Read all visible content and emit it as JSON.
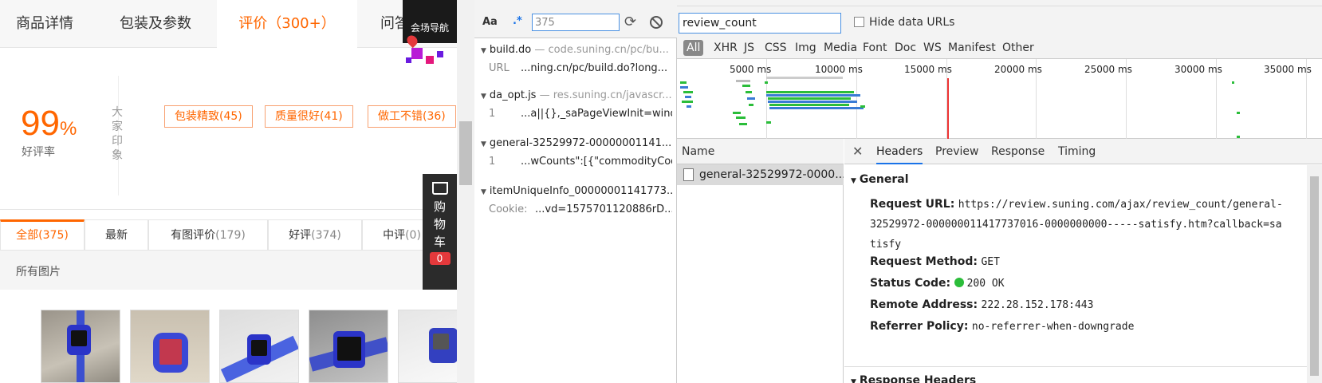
{
  "product_page": {
    "tabs": [
      "商品详情",
      "包装及参数",
      "评价（300+）",
      "问答"
    ],
    "side_nav_label": "会场导航",
    "rating": {
      "value": "99",
      "unit": "%",
      "label": "好评率"
    },
    "impression_title": "大家印象",
    "tags": [
      "包装精致(45)",
      "质量很好(41)",
      "做工不错(36)"
    ],
    "filter_tabs": [
      {
        "label": "全部",
        "count": "(375)"
      },
      {
        "label": "最新",
        "count": ""
      },
      {
        "label": "有图评价",
        "count": "(179)"
      },
      {
        "label": "好评",
        "count": "(374)"
      },
      {
        "label": "中评",
        "count": "(0)"
      }
    ],
    "all_images_label": "所有图片",
    "cart": {
      "chars": [
        "购",
        "物",
        "车"
      ],
      "count": "0"
    }
  },
  "search_panel": {
    "aa_label": "Aa",
    "regex_label": ".*",
    "query": "375",
    "results": [
      {
        "file": "build.do",
        "path": "— code.suning.cn/pc/bu...",
        "line_num": "URL",
        "line": "...ning.cn/pc/build.do?long..."
      },
      {
        "file": "da_opt.js",
        "path": "— res.suning.cn/javascr...",
        "line_num": "1",
        "line": "...a||{},_saPageViewInit=windo..."
      },
      {
        "file": "general-32529972-00000001141...",
        "path": "",
        "line_num": "1",
        "line": "...wCounts\":[{\"commodityCode..."
      },
      {
        "file": "itemUniqueInfo_00000001141773...",
        "path": "",
        "line_num": "Cookie:",
        "line": "...vd=1575701120886rD..."
      }
    ]
  },
  "network": {
    "filter_value": "review_count",
    "hide_data_urls": "Hide data URLs",
    "types": [
      "All",
      "XHR",
      "JS",
      "CSS",
      "Img",
      "Media",
      "Font",
      "Doc",
      "WS",
      "Manifest",
      "Other"
    ],
    "timeline_labels": [
      "5000 ms",
      "10000 ms",
      "15000 ms",
      "20000 ms",
      "25000 ms",
      "30000 ms",
      "35000 ms"
    ],
    "list_header": "Name",
    "request_name": "general-32529972-0000...",
    "detail_tabs": [
      "Headers",
      "Preview",
      "Response",
      "Timing"
    ],
    "general_label": "General",
    "request_url_key": "Request URL:",
    "request_url": "https://review.suning.com/ajax/review_count/general-32529972-000000011417737016-0000000000-----satisfy.htm?callback=satisfy",
    "request_method_key": "Request Method:",
    "request_method": "GET",
    "status_code_key": "Status Code:",
    "status_code": "200 OK",
    "remote_address_key": "Remote Address:",
    "remote_address": "222.28.152.178:443",
    "referrer_policy_key": "Referrer Policy:",
    "referrer_policy": "no-referrer-when-downgrade",
    "response_headers_label": "Response Headers"
  },
  "colors": {
    "accent": "#ff6600",
    "devtools_blue": "#1a73e8",
    "status_green": "#2bbd3a"
  }
}
